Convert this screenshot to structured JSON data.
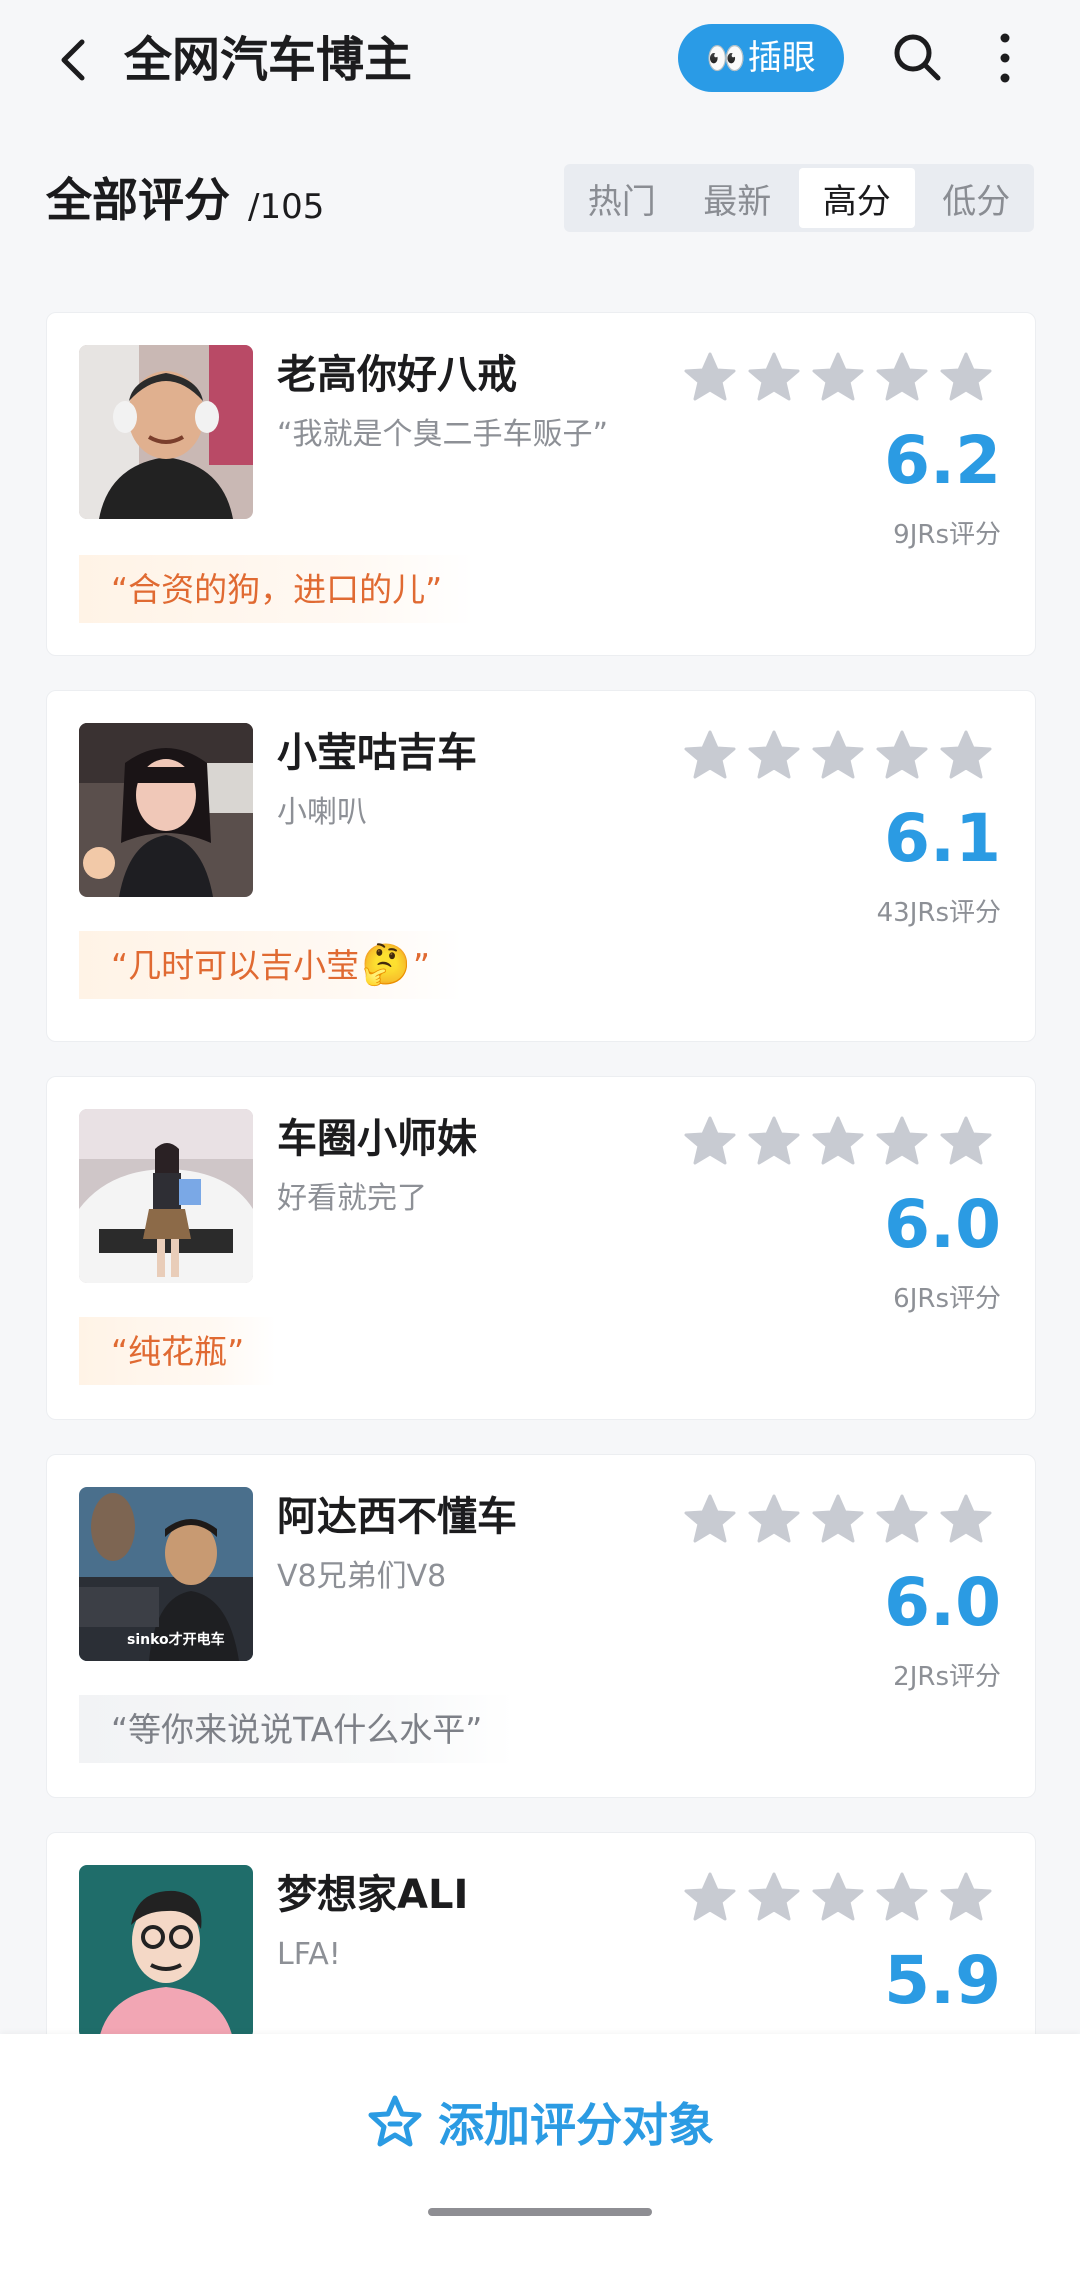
{
  "header": {
    "title": "全网汽车博主",
    "eye_button_emoji": "👀",
    "eye_button_label": "插眼",
    "accent_color": "#2a9be6"
  },
  "section": {
    "title": "全部评分",
    "count": "/105",
    "tabs": [
      {
        "label": "热门",
        "active": false
      },
      {
        "label": "最新",
        "active": false
      },
      {
        "label": "高分",
        "active": true
      },
      {
        "label": "低分",
        "active": false
      }
    ]
  },
  "cards": [
    {
      "name": "老高你好八戒",
      "subtitle": "“我就是个臭二手车贩子”",
      "score": "6.2",
      "votes": "9JRs评分",
      "comment": "“合资的狗，进口的儿”",
      "comment_style": "orange"
    },
    {
      "name": "小莹咕吉车",
      "subtitle": "小喇叭",
      "score": "6.1",
      "votes": "43JRs评分",
      "comment": "“几时可以吉小莹",
      "comment_emoji": "🤔",
      "comment_tail": "”",
      "comment_style": "orange"
    },
    {
      "name": "车圈小师妹",
      "subtitle": "好看就完了",
      "score": "6.0",
      "votes": "6JRs评分",
      "comment": "“纯花瓶”",
      "comment_style": "orange"
    },
    {
      "name": "阿达西不懂车",
      "subtitle": "V8兄弟们V8",
      "score": "6.0",
      "votes": "2JRs评分",
      "comment": "“等你来说说TA什么水平”",
      "comment_style": "gray",
      "avatar_caption": "sinko才开电车"
    },
    {
      "name": "梦想家ALI",
      "subtitle": "LFA!",
      "score": "5.9"
    }
  ],
  "bottom": {
    "add_label": "添加评分对象"
  }
}
